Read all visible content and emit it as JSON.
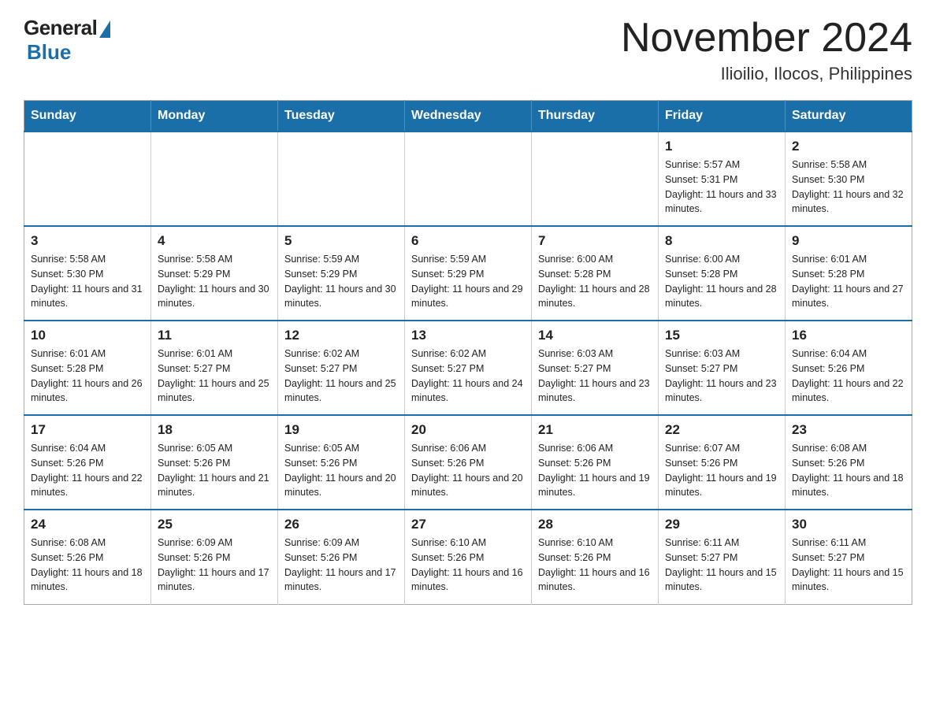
{
  "logo": {
    "general": "General",
    "blue": "Blue"
  },
  "header": {
    "month": "November 2024",
    "location": "Ilioilio, Ilocos, Philippines"
  },
  "days_of_week": [
    "Sunday",
    "Monday",
    "Tuesday",
    "Wednesday",
    "Thursday",
    "Friday",
    "Saturday"
  ],
  "weeks": [
    [
      {
        "day": "",
        "info": ""
      },
      {
        "day": "",
        "info": ""
      },
      {
        "day": "",
        "info": ""
      },
      {
        "day": "",
        "info": ""
      },
      {
        "day": "",
        "info": ""
      },
      {
        "day": "1",
        "info": "Sunrise: 5:57 AM\nSunset: 5:31 PM\nDaylight: 11 hours and 33 minutes."
      },
      {
        "day": "2",
        "info": "Sunrise: 5:58 AM\nSunset: 5:30 PM\nDaylight: 11 hours and 32 minutes."
      }
    ],
    [
      {
        "day": "3",
        "info": "Sunrise: 5:58 AM\nSunset: 5:30 PM\nDaylight: 11 hours and 31 minutes."
      },
      {
        "day": "4",
        "info": "Sunrise: 5:58 AM\nSunset: 5:29 PM\nDaylight: 11 hours and 30 minutes."
      },
      {
        "day": "5",
        "info": "Sunrise: 5:59 AM\nSunset: 5:29 PM\nDaylight: 11 hours and 30 minutes."
      },
      {
        "day": "6",
        "info": "Sunrise: 5:59 AM\nSunset: 5:29 PM\nDaylight: 11 hours and 29 minutes."
      },
      {
        "day": "7",
        "info": "Sunrise: 6:00 AM\nSunset: 5:28 PM\nDaylight: 11 hours and 28 minutes."
      },
      {
        "day": "8",
        "info": "Sunrise: 6:00 AM\nSunset: 5:28 PM\nDaylight: 11 hours and 28 minutes."
      },
      {
        "day": "9",
        "info": "Sunrise: 6:01 AM\nSunset: 5:28 PM\nDaylight: 11 hours and 27 minutes."
      }
    ],
    [
      {
        "day": "10",
        "info": "Sunrise: 6:01 AM\nSunset: 5:28 PM\nDaylight: 11 hours and 26 minutes."
      },
      {
        "day": "11",
        "info": "Sunrise: 6:01 AM\nSunset: 5:27 PM\nDaylight: 11 hours and 25 minutes."
      },
      {
        "day": "12",
        "info": "Sunrise: 6:02 AM\nSunset: 5:27 PM\nDaylight: 11 hours and 25 minutes."
      },
      {
        "day": "13",
        "info": "Sunrise: 6:02 AM\nSunset: 5:27 PM\nDaylight: 11 hours and 24 minutes."
      },
      {
        "day": "14",
        "info": "Sunrise: 6:03 AM\nSunset: 5:27 PM\nDaylight: 11 hours and 23 minutes."
      },
      {
        "day": "15",
        "info": "Sunrise: 6:03 AM\nSunset: 5:27 PM\nDaylight: 11 hours and 23 minutes."
      },
      {
        "day": "16",
        "info": "Sunrise: 6:04 AM\nSunset: 5:26 PM\nDaylight: 11 hours and 22 minutes."
      }
    ],
    [
      {
        "day": "17",
        "info": "Sunrise: 6:04 AM\nSunset: 5:26 PM\nDaylight: 11 hours and 22 minutes."
      },
      {
        "day": "18",
        "info": "Sunrise: 6:05 AM\nSunset: 5:26 PM\nDaylight: 11 hours and 21 minutes."
      },
      {
        "day": "19",
        "info": "Sunrise: 6:05 AM\nSunset: 5:26 PM\nDaylight: 11 hours and 20 minutes."
      },
      {
        "day": "20",
        "info": "Sunrise: 6:06 AM\nSunset: 5:26 PM\nDaylight: 11 hours and 20 minutes."
      },
      {
        "day": "21",
        "info": "Sunrise: 6:06 AM\nSunset: 5:26 PM\nDaylight: 11 hours and 19 minutes."
      },
      {
        "day": "22",
        "info": "Sunrise: 6:07 AM\nSunset: 5:26 PM\nDaylight: 11 hours and 19 minutes."
      },
      {
        "day": "23",
        "info": "Sunrise: 6:08 AM\nSunset: 5:26 PM\nDaylight: 11 hours and 18 minutes."
      }
    ],
    [
      {
        "day": "24",
        "info": "Sunrise: 6:08 AM\nSunset: 5:26 PM\nDaylight: 11 hours and 18 minutes."
      },
      {
        "day": "25",
        "info": "Sunrise: 6:09 AM\nSunset: 5:26 PM\nDaylight: 11 hours and 17 minutes."
      },
      {
        "day": "26",
        "info": "Sunrise: 6:09 AM\nSunset: 5:26 PM\nDaylight: 11 hours and 17 minutes."
      },
      {
        "day": "27",
        "info": "Sunrise: 6:10 AM\nSunset: 5:26 PM\nDaylight: 11 hours and 16 minutes."
      },
      {
        "day": "28",
        "info": "Sunrise: 6:10 AM\nSunset: 5:26 PM\nDaylight: 11 hours and 16 minutes."
      },
      {
        "day": "29",
        "info": "Sunrise: 6:11 AM\nSunset: 5:27 PM\nDaylight: 11 hours and 15 minutes."
      },
      {
        "day": "30",
        "info": "Sunrise: 6:11 AM\nSunset: 5:27 PM\nDaylight: 11 hours and 15 minutes."
      }
    ]
  ]
}
